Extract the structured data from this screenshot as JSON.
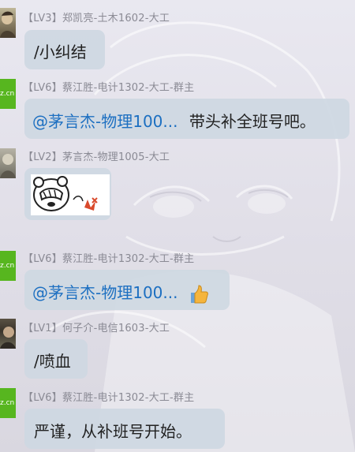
{
  "messages": [
    {
      "nickname": "【LV3】郑凯亮-土木1602-大工",
      "text": "/小纠结",
      "avatar": "photo-avatar-1"
    },
    {
      "nickname": "【LV6】蔡江胜-电计1302-大工-群主",
      "mention": "@茅言杰-物理100...",
      "text": "带头补全班号吧。",
      "avatar_text": "z.cn"
    },
    {
      "nickname": "【LV2】茅言杰-物理1005-大工",
      "sticker": "facepalm-bear-sticker",
      "avatar": "photo-avatar-2"
    },
    {
      "nickname": "【LV6】蔡江胜-电计1302-大工-群主",
      "mention": "@茅言杰-物理100...",
      "emoji": "thumbs-up-emoji",
      "avatar_text": "z.cn"
    },
    {
      "nickname": "【LV1】何子介-电信1603-大工",
      "text": "/喷血",
      "avatar": "photo-avatar-3"
    },
    {
      "nickname": "【LV6】蔡江胜-电计1302-大工-群主",
      "text": "严谨，从补班号开始。",
      "avatar_text": "z.cn"
    }
  ],
  "colors": {
    "bubble": "#ced8e2",
    "mention": "#1c6fc1",
    "nickname": "#8a8a94",
    "avatar_green": "#57b61f"
  }
}
